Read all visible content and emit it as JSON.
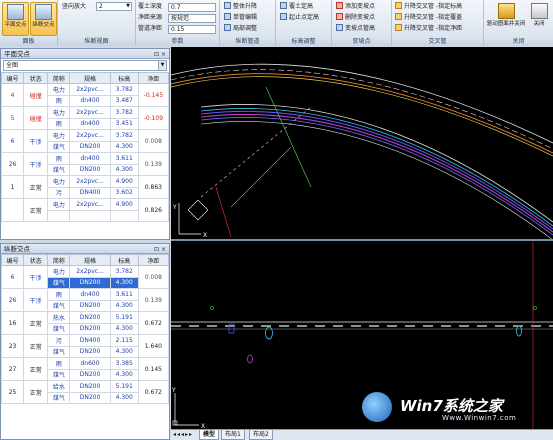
{
  "ribbon": {
    "groups": {
      "panel": {
        "label": "面板",
        "buttons": [
          "平面交点",
          "纵断交点"
        ]
      },
      "profile_view": {
        "label": "纵断视图",
        "zoom_label": "竖向放大",
        "zoom_value": "2"
      },
      "params": {
        "label": "参数",
        "fields": [
          {
            "label": "覆土深度",
            "value": "0.7"
          },
          {
            "label": "净距来源",
            "value": "按规范"
          },
          {
            "label": "管道净距",
            "value": "0.15"
          }
        ]
      },
      "pipe_adjust": {
        "label": "纵断管道",
        "items": [
          "整体升降",
          "单管编辑",
          "局部调整"
        ]
      },
      "elev_adjust": {
        "label": "标高调整",
        "items": [
          "覆土定高",
          "起止点定高"
        ]
      },
      "vertex": {
        "label": "变坡点",
        "items": [
          "添加变坡点",
          "删除变坡点",
          "变坡点管高"
        ]
      },
      "crossing": {
        "label": "交叉管",
        "items": [
          "升降交叉管 -指定标高",
          "升降交叉管 -指定覆盖",
          "升降交叉管 -指定净距"
        ]
      },
      "close": {
        "label": "关闭",
        "export_label": "驱动图面并关闭",
        "close_label": "关闭"
      }
    }
  },
  "plan_panel": {
    "title": "平面交点",
    "filter": "全图",
    "columns": [
      "编号",
      "状态",
      "简称",
      "规格",
      "标高",
      "净距"
    ],
    "rows": [
      {
        "id": "4",
        "status": "碰撞",
        "status_type": "collision",
        "names": [
          "电力",
          "雨"
        ],
        "specs": [
          "2x2pvc...",
          "dn400"
        ],
        "elevs": [
          "3.782",
          "3.487"
        ],
        "gap": "-0.145"
      },
      {
        "id": "5",
        "status": "碰撞",
        "status_type": "collision",
        "names": [
          "电力",
          "雨"
        ],
        "specs": [
          "2x2pvc...",
          "dn400"
        ],
        "elevs": [
          "3.782",
          "3.451"
        ],
        "gap": "-0.109"
      },
      {
        "id": "6",
        "status": "干涉",
        "status_type": "interference",
        "names": [
          "电力",
          "煤气"
        ],
        "specs": [
          "2x2pvc...",
          "DN200"
        ],
        "elevs": [
          "3.782",
          "4.300"
        ],
        "gap": "0.008"
      },
      {
        "id": "26",
        "status": "干涉",
        "status_type": "interference",
        "names": [
          "雨",
          "煤气"
        ],
        "specs": [
          "dn400",
          "DN200"
        ],
        "elevs": [
          "3.611",
          "4.300"
        ],
        "gap": "0.139"
      },
      {
        "id": "1",
        "status": "正常",
        "status_type": "normal",
        "names": [
          "电力",
          "污"
        ],
        "specs": [
          "2x2pvc...",
          "DN400"
        ],
        "elevs": [
          "4.900",
          "3.602"
        ],
        "gap": "0.863"
      },
      {
        "id": "",
        "status": "正常",
        "status_type": "normal",
        "names": [
          "电力",
          ""
        ],
        "specs": [
          "2x2pvc...",
          ""
        ],
        "elevs": [
          "4.900",
          ""
        ],
        "gap": "0.826"
      }
    ]
  },
  "profile_panel": {
    "title": "纵断交点",
    "columns": [
      "编号",
      "状态",
      "简称",
      "规格",
      "标高",
      "净距"
    ],
    "rows": [
      {
        "id": "6",
        "status": "干涉",
        "status_type": "interference",
        "names": [
          "电力",
          "煤气"
        ],
        "specs": [
          "2x2pvc...",
          "DN200"
        ],
        "elevs": [
          "3.782",
          "4.300"
        ],
        "gap": "0.008",
        "selected_sub": 1
      },
      {
        "id": "26",
        "status": "干涉",
        "status_type": "interference",
        "names": [
          "雨",
          "煤气"
        ],
        "specs": [
          "dn400",
          "DN200"
        ],
        "elevs": [
          "3.611",
          "4.300"
        ],
        "gap": "0.139"
      },
      {
        "id": "16",
        "status": "正常",
        "status_type": "normal",
        "names": [
          "热水",
          "煤气"
        ],
        "specs": [
          "DN200",
          "DN200"
        ],
        "elevs": [
          "5.191",
          "4.300"
        ],
        "gap": "0.672"
      },
      {
        "id": "23",
        "status": "正常",
        "status_type": "normal",
        "names": [
          "污",
          "煤气"
        ],
        "specs": [
          "DN400",
          "DN200"
        ],
        "elevs": [
          "2.115",
          "4.300"
        ],
        "gap": "1.640"
      },
      {
        "id": "27",
        "status": "正常",
        "status_type": "normal",
        "names": [
          "雨",
          "煤气"
        ],
        "specs": [
          "dn600",
          "DN200"
        ],
        "elevs": [
          "3.385",
          "4.300"
        ],
        "gap": "0.145"
      },
      {
        "id": "25",
        "status": "正常",
        "status_type": "normal",
        "names": [
          "给水",
          "煤气"
        ],
        "specs": [
          "DN200",
          "DN200"
        ],
        "elevs": [
          "5.191",
          "4.300"
        ],
        "gap": "0.672"
      }
    ]
  },
  "drawing": {
    "ucs_plan": {
      "y": "Y",
      "x": "X"
    },
    "ucs_profile": {
      "y": "Y",
      "x": "X"
    }
  },
  "tabs": [
    "模型",
    "布局1",
    "布局2"
  ],
  "watermark": {
    "text": "Win7系统之家",
    "url": "Www.Winwin7.com"
  },
  "colors": {
    "collision": "#d0271c",
    "interference": "#1a45b8",
    "selected_row": "#2f6bd2",
    "canvas": "#000000"
  }
}
